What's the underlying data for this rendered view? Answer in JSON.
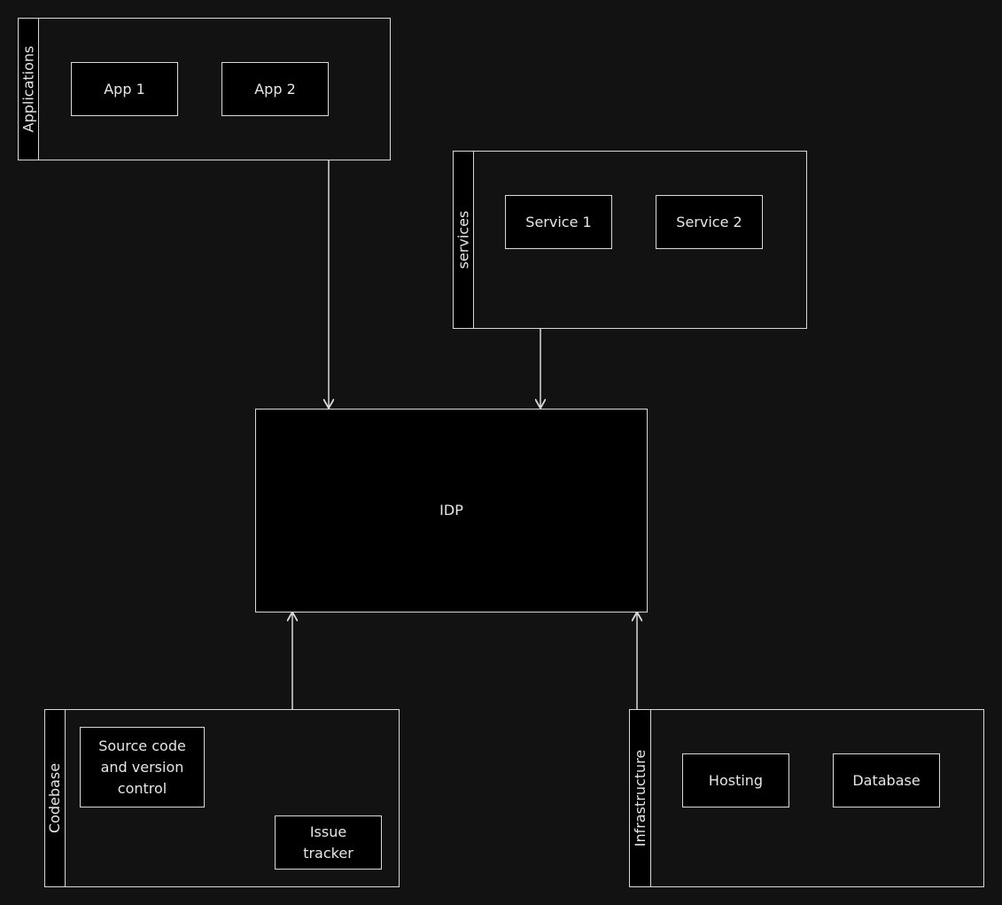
{
  "groups": {
    "applications": {
      "label": "Applications",
      "items": [
        "App 1",
        "App 2"
      ]
    },
    "services": {
      "label": "services",
      "items": [
        "Service 1",
        "Service 2"
      ]
    },
    "codebase": {
      "label": "Codebase",
      "items": [
        "Source code and version control",
        "Issue tracker"
      ]
    },
    "infrastructure": {
      "label": "Infrastructure",
      "items": [
        "Hosting",
        "Database"
      ]
    }
  },
  "idp": {
    "label": "IDP"
  },
  "colors": {
    "background": "#121212",
    "stroke": "#d9d9d9",
    "fill": "#000000"
  }
}
